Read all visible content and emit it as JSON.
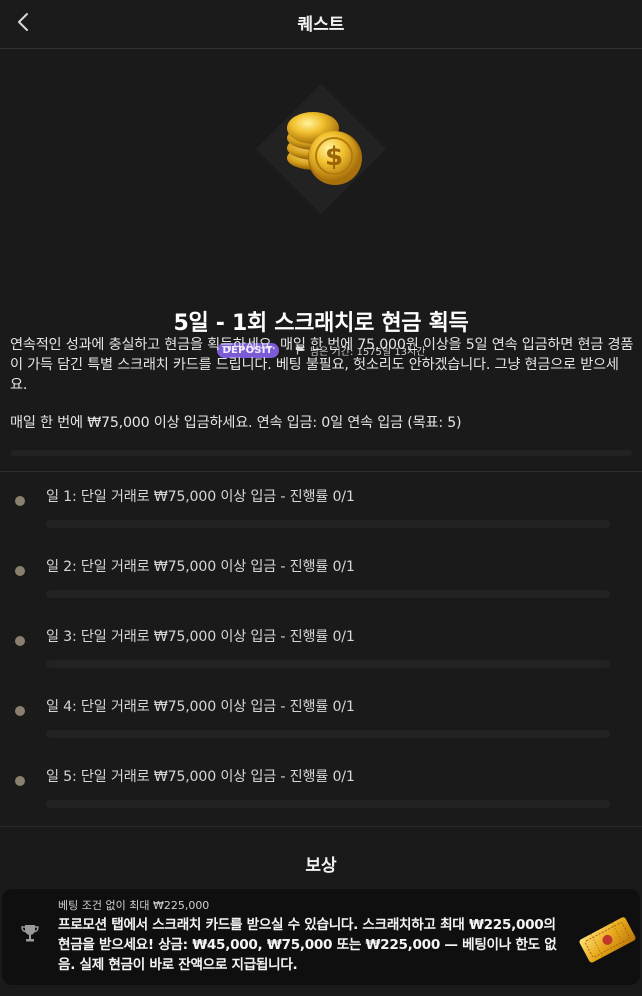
{
  "header": {
    "title": "퀘스트",
    "back_icon": "chevron-left-icon"
  },
  "hero": {
    "image_icon": "gold-coins-icon",
    "title": "5일 - 1회 스크래치로 현금 획득",
    "badge": "DEPOSIT",
    "time_icon": "flag-icon",
    "remaining": "남은 기간: 1575일 13시간"
  },
  "description": "연속적인 성과에 충실하고 현금을 획득하세요. 매일 한 번에 75,000원 이상을 5일 연속 입금하면 현금 경품이 가득 담긴 특별 스크래치 카드를 드립니다. 베팅 불필요, 헛소리도 안하겠습니다. 그냥 현금으로 받으세요.",
  "instruction": "매일 한 번에 ₩75,000 이상 입금하세요. 연속 입금: 0일 연속 입금 (목표: 5)",
  "progress": {
    "streak": 0,
    "goal": 5
  },
  "steps": [
    {
      "label": "일 1: 단일 거래로 ₩75,000 이상 입금 - 진행률 0/1",
      "progress": 0
    },
    {
      "label": "일 2: 단일 거래로 ₩75,000 이상 입금 - 진행률 0/1",
      "progress": 0
    },
    {
      "label": "일 3: 단일 거래로 ₩75,000 이상 입금 - 진행률 0/1",
      "progress": 0
    },
    {
      "label": "일 4: 단일 거래로 ₩75,000 이상 입금 - 진행률 0/1",
      "progress": 0
    },
    {
      "label": "일 5: 단일 거래로 ₩75,000 이상 입금 - 진행률 0/1",
      "progress": 0
    }
  ],
  "reward": {
    "title": "보상",
    "icon": "trophy-icon",
    "subtitle": "베팅 조건 없이 최대 ₩225,000",
    "text": "프로모션 탭에서 스크래치 카드를 받으실 수 있습니다. 스크래치하고 최대 ₩225,000의 현금을 받으세요! 상금: ₩45,000, ₩75,000 또는 ₩225,000 — 베팅이나 한도 없음. 실제 현금이 바로 잔액으로 지급됩니다.",
    "image_icon": "golden-ticket-icon"
  },
  "colors": {
    "background": "#1a1a1a",
    "badge": "#7c5bd6",
    "step_dot": "#8a8070",
    "card": "#0f0f0f"
  }
}
